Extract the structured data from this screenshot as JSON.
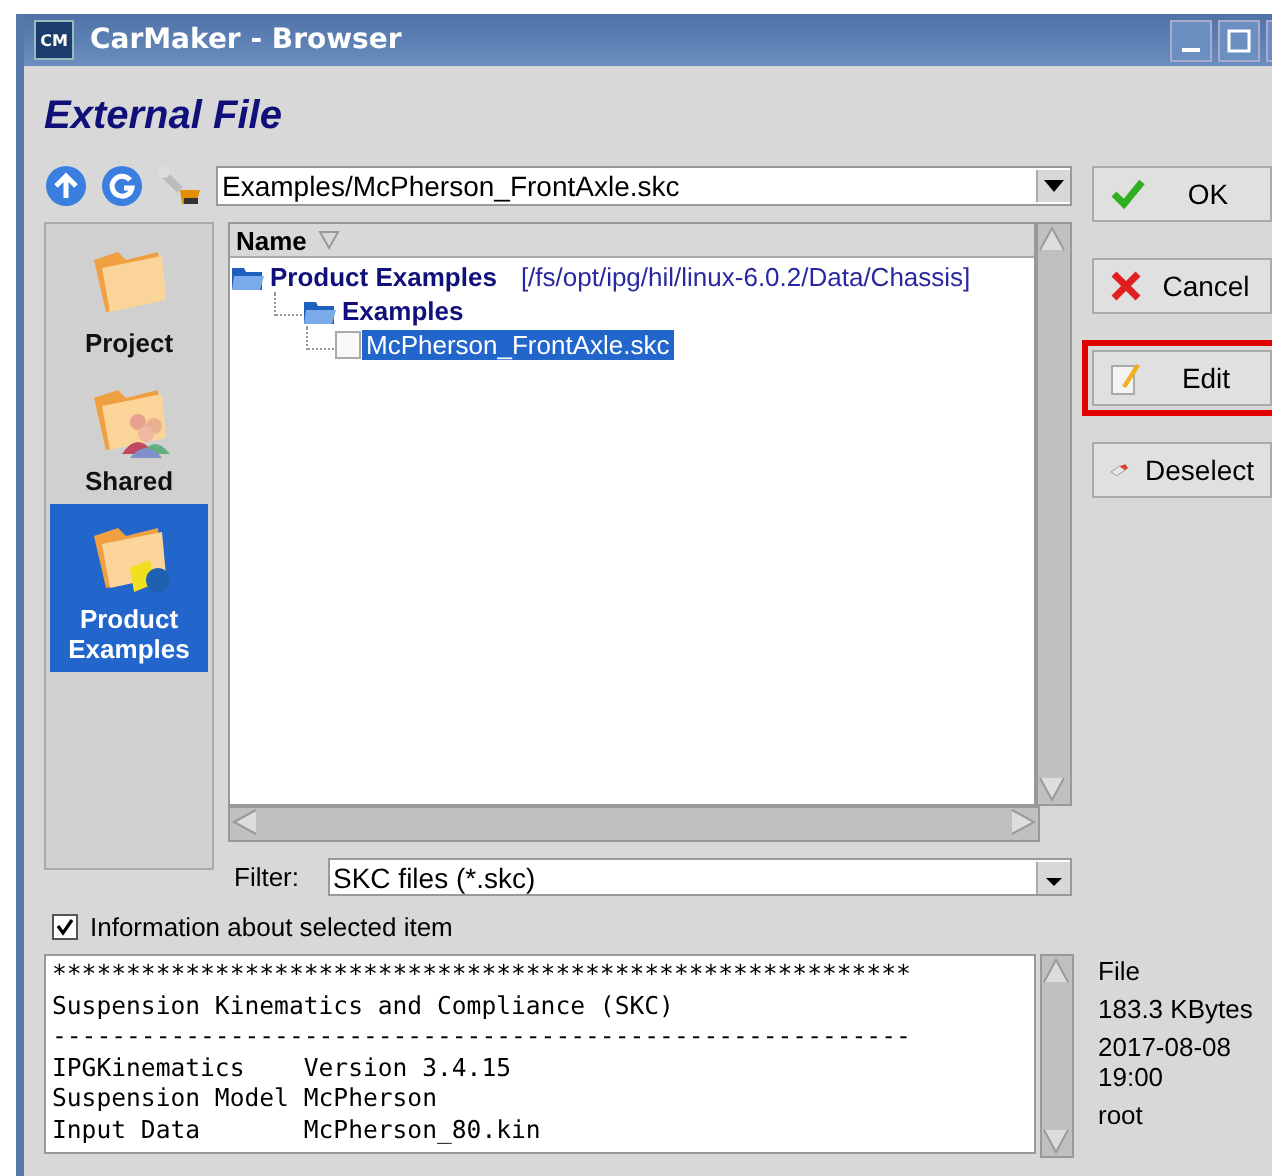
{
  "window": {
    "title": "CarMaker - Browser",
    "logo": "CM"
  },
  "heading": "External File",
  "path_field": {
    "value": "Examples/McPherson_FrontAxle.skc"
  },
  "sidebar": {
    "items": [
      {
        "label": "Project",
        "kind": "project",
        "selected": false
      },
      {
        "label": "Shared",
        "kind": "shared",
        "selected": false
      },
      {
        "label": "Product Examples",
        "kind": "product",
        "selected": true
      }
    ]
  },
  "tree": {
    "column": "Name",
    "items": [
      {
        "label": "Product Examples",
        "path": "[/fs/opt/ipg/hil/linux-6.0.2/Data/Chassis]",
        "kind": "folder",
        "selected": false,
        "children": [
          {
            "label": "Examples",
            "kind": "folder",
            "selected": false,
            "children": [
              {
                "label": "McPherson_FrontAxle.skc",
                "kind": "file",
                "selected": true
              }
            ]
          }
        ]
      }
    ]
  },
  "filter": {
    "label": "Filter:",
    "value": "SKC files (*.skc)"
  },
  "info_toggle": {
    "label": "Information about selected item",
    "checked": true
  },
  "info_text": [
    "**********************************************************",
    "Suspension Kinematics and Compliance (SKC)",
    "----------------------------------------------------------",
    "IPGKinematics    Version 3.4.15",
    "Suspension Model McPherson",
    "Input Data       McPherson_80.kin"
  ],
  "details": [
    "File",
    "183.3 KBytes",
    "2017-08-08 19:00",
    "root"
  ],
  "buttons": [
    {
      "label": "OK",
      "kind": "ok",
      "highlighted": false
    },
    {
      "label": "Cancel",
      "kind": "cancel",
      "highlighted": false
    },
    {
      "label": "Edit",
      "kind": "edit",
      "highlighted": true
    },
    {
      "label": "Deselect",
      "kind": "deselect",
      "highlighted": false
    }
  ]
}
